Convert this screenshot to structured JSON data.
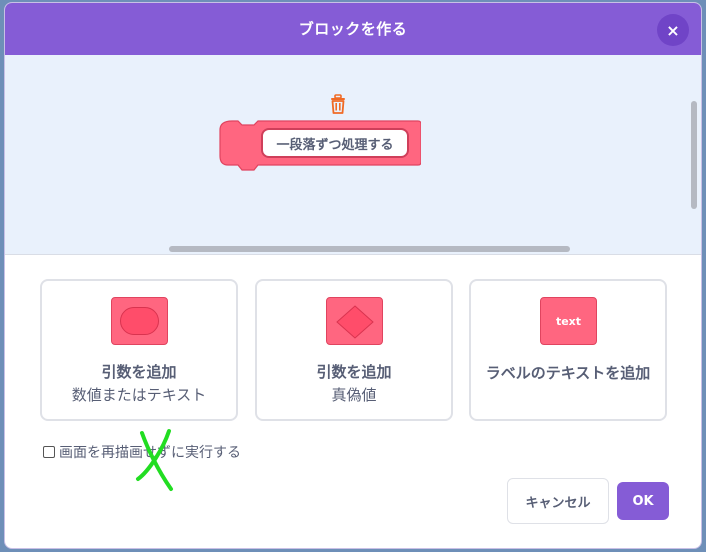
{
  "dialog": {
    "title": "ブロックを作る",
    "close_icon": "×"
  },
  "workspace": {
    "block_label": "一段落ずつ処理する",
    "block_color": "#ff6680",
    "trash_icon": "trash-icon"
  },
  "options": [
    {
      "title": "引数を追加",
      "subtitle": "数値またはテキスト",
      "icon": "round-input-icon"
    },
    {
      "title": "引数を追加",
      "subtitle": "真偽値",
      "icon": "hexagon-input-icon"
    },
    {
      "title": "ラベルのテキストを追加",
      "icon_text": "text"
    }
  ],
  "checkbox": {
    "label": "画面を再描画せずに実行する",
    "checked": false
  },
  "buttons": {
    "cancel": "キャンセル",
    "ok": "OK"
  },
  "colors": {
    "header": "#855cd6",
    "block": "#ff6680",
    "workspace_bg": "#e9f1fc",
    "annotation": "#22dd22"
  }
}
